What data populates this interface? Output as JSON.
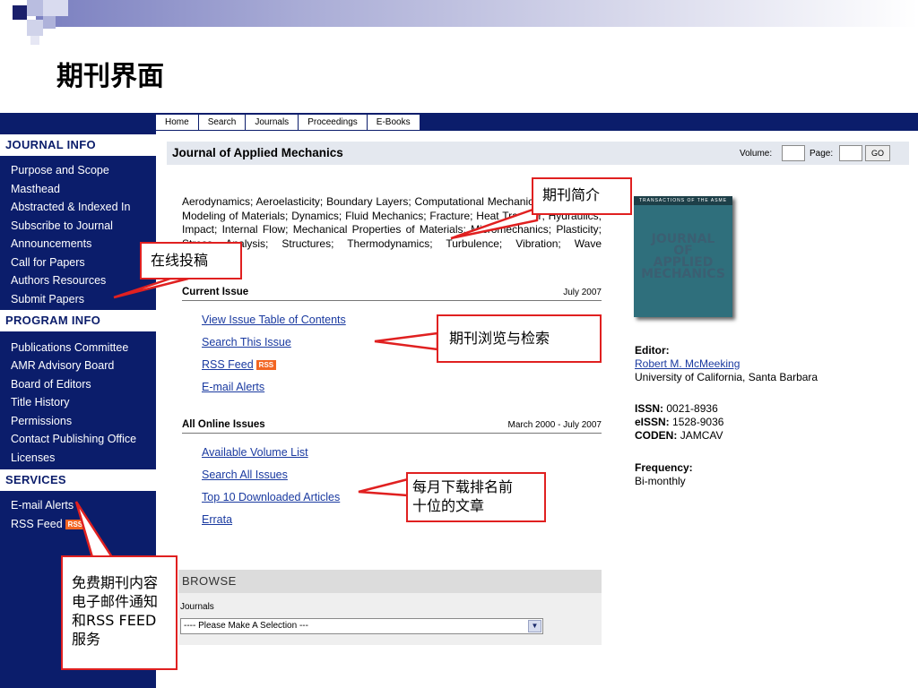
{
  "slide": {
    "title": "期刊界面"
  },
  "colors": {
    "nav": "#0b1d6b",
    "link": "#1a3aa0",
    "callout_border": "#e02020",
    "rss": "#f26522"
  },
  "topnav": [
    "Home",
    "Search",
    "Journals",
    "Proceedings",
    "E-Books"
  ],
  "sidebar": {
    "journal_info": {
      "heading": "JOURNAL INFO",
      "items": [
        "Purpose and Scope",
        "Masthead",
        "Abstracted & Indexed In",
        "Subscribe to Journal",
        "Announcements",
        "Call for Papers",
        "Authors Resources",
        "Submit Papers"
      ]
    },
    "program_info": {
      "heading": "PROGRAM INFO",
      "items": [
        "Publications Committee",
        "AMR Advisory Board",
        "Board of Editors",
        "Title History",
        "Permissions",
        "Contact Publishing Office",
        "Licenses"
      ]
    },
    "services": {
      "heading": "SERVICES",
      "items": [
        "E-mail Alerts",
        "RSS Feed"
      ]
    }
  },
  "journal": {
    "title": "Journal of Applied Mechanics",
    "volume_label": "Volume:",
    "page_label": "Page:",
    "go_label": "GO",
    "description": "Aerodynamics; Aeroelasticity; Boundary Layers; Computational Mechanics; Constitutive Modeling of Materials; Dynamics; Fluid Mechanics; Fracture; Heat Transfer; Hydraulics; Impact; Internal Flow; Mechanical Properties of Materials; Micromechanics; Plasticity; Stress Analysis; Structures; Thermodynamics; Turbulence; Vibration; Wave Propagation."
  },
  "current_issue": {
    "label": "Current Issue",
    "date": "July 2007",
    "links": [
      "View Issue Table of Contents",
      "Search This Issue",
      "RSS Feed",
      "E-mail Alerts"
    ]
  },
  "all_issues": {
    "label": "All Online Issues",
    "date": "March 2000  - July 2007",
    "links": [
      "Available Volume List",
      "Search All Issues",
      "Top 10 Downloaded Articles",
      "Errata"
    ]
  },
  "rss_badge": "RSS",
  "browse": {
    "heading": "BROWSE",
    "label": "Journals",
    "selected": "---- Please Make A Selection ---"
  },
  "cover": {
    "banner": "TRANSACTIONS OF THE ASME",
    "line1": "JOURNAL",
    "line2": "OF",
    "line3": "APPLIED",
    "line4": "MECHANICS"
  },
  "info": {
    "editor_label": "Editor:",
    "editor_name": "Robert M. McMeeking",
    "editor_affiliation": "University of California, Santa Barbara",
    "issn_label": "ISSN:",
    "issn": "0021-8936",
    "eissn_label": "eISSN:",
    "eissn": "1528-9036",
    "coden_label": "CODEN:",
    "coden": "JAMCAV",
    "frequency_label": "Frequency:",
    "frequency": "Bi-monthly"
  },
  "annotations": {
    "intro": "期刊简介",
    "submit": "在线投稿",
    "browse": "期刊浏览与检索",
    "top10_line1": "每月下载排名前",
    "top10_line2": "十位的文章",
    "alerts": "免费期刊内容电子邮件通知和RSS FEED 服务"
  }
}
